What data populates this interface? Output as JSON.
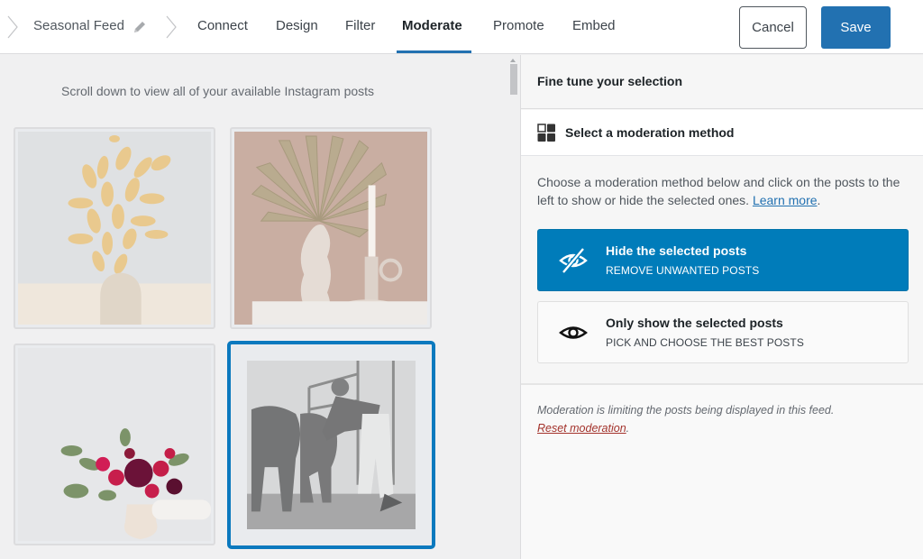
{
  "header": {
    "feed_name": "Seasonal Feed",
    "tabs": [
      {
        "label": "Connect",
        "active": false
      },
      {
        "label": "Design",
        "active": false
      },
      {
        "label": "Filter",
        "active": false
      },
      {
        "label": "Moderate",
        "active": true
      },
      {
        "label": "Promote",
        "active": false
      },
      {
        "label": "Embed",
        "active": false
      }
    ],
    "cancel_label": "Cancel",
    "save_label": "Save",
    "accent_color": "#2271b1"
  },
  "preview": {
    "scroll_hint": "Scroll down to view all of your available Instagram posts",
    "posts": [
      {
        "subject": "dried bunny-tail grass in white vase",
        "selected": false
      },
      {
        "subject": "dried palm leaf in wavy vase with candle holder",
        "selected": false
      },
      {
        "subject": "red flower bouquet in vase",
        "selected": false
      },
      {
        "subject": "people stretching in gym",
        "selected": true
      }
    ],
    "selected_color": "#0b79be"
  },
  "panel": {
    "title": "Fine tune your selection",
    "section_title": "Select a moderation method",
    "description": "Choose a moderation method below and click on the posts to the left to show or hide the selected ones.",
    "learn_more": "Learn more",
    "options": [
      {
        "title": "Hide the selected posts",
        "subtitle": "REMOVE UNWANTED POSTS",
        "icon": "eye-slash-icon",
        "active": true
      },
      {
        "title": "Only show the selected posts",
        "subtitle": "PICK AND CHOOSE THE BEST POSTS",
        "icon": "eye-icon",
        "active": false
      }
    ],
    "active_color": "#007cba",
    "notice": "Moderation is limiting the posts being displayed in this feed.",
    "reset_label": "Reset moderation",
    "reset_color": "#a3322b"
  }
}
